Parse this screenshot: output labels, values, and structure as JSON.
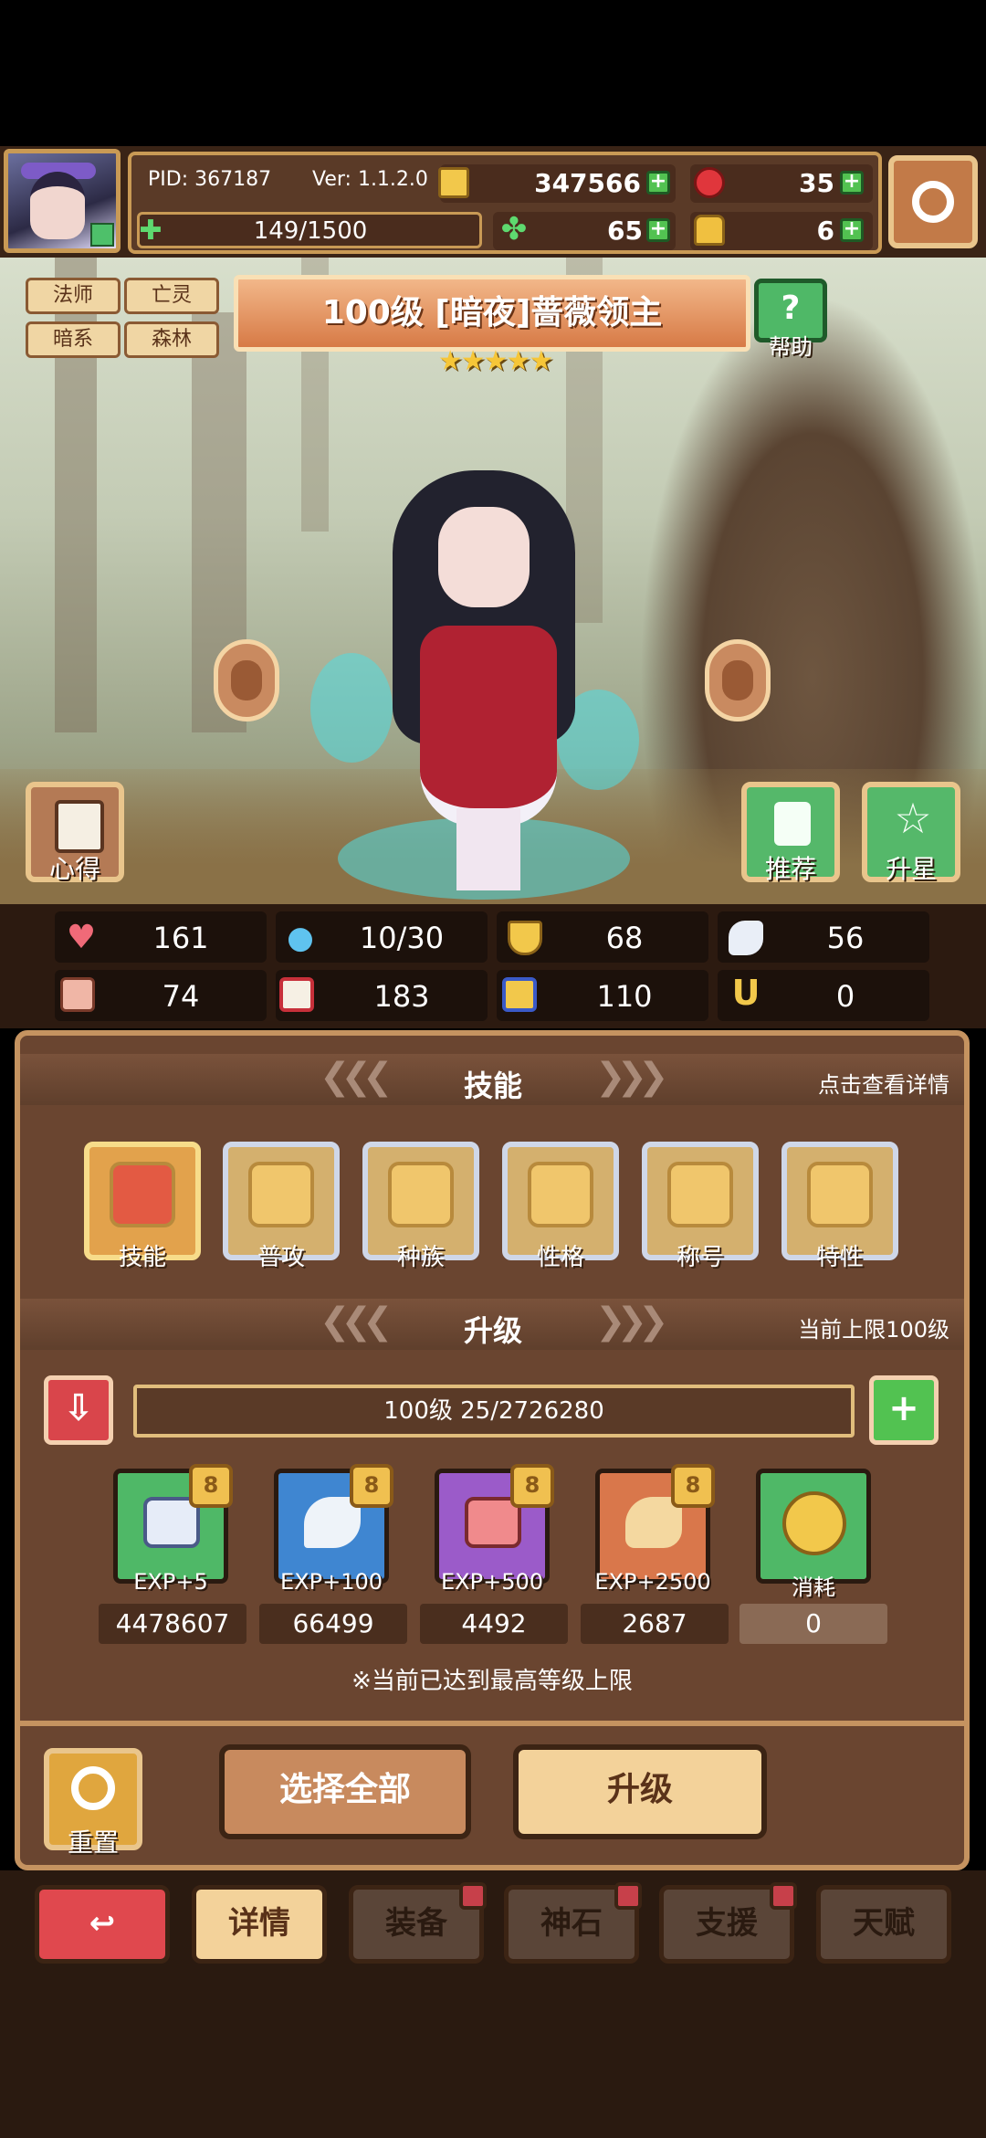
{
  "header": {
    "pid": "PID: 367187",
    "version": "Ver: 1.1.2.0",
    "gold": "347566",
    "ruby": "35",
    "stamina": "149/1500",
    "clover": "65",
    "bag": "6"
  },
  "hero": {
    "tags": [
      "法师",
      "亡灵",
      "暗系",
      "森林"
    ],
    "title": "100级 [暗夜]蔷薇领主",
    "stars": "★★★★★",
    "help_label": "帮助",
    "notes_label": "心得",
    "recommend_label": "推荐",
    "upgrade_star_label": "升星"
  },
  "stats": {
    "hp": "161",
    "mana": "10/30",
    "defense": "68",
    "speed": "56",
    "attack": "74",
    "magic": "183",
    "resist": "110",
    "luck": "0"
  },
  "skills_section": {
    "title": "技能",
    "note": "点击查看详情",
    "items": [
      "技能",
      "普攻",
      "种族",
      "性格",
      "称号",
      "特性"
    ]
  },
  "level_section": {
    "title": "升级",
    "note": "当前上限100级",
    "progress": "100级  25/2726280",
    "items": [
      {
        "label": "EXP+5",
        "count": "4478607"
      },
      {
        "label": "EXP+100",
        "count": "66499"
      },
      {
        "label": "EXP+500",
        "count": "4492"
      },
      {
        "label": "EXP+2500",
        "count": "2687"
      },
      {
        "label": "消耗",
        "count": "0"
      }
    ],
    "notice": "※当前已达到最高等级上限"
  },
  "actions": {
    "reset": "重置",
    "select_all": "选择全部",
    "upgrade": "升级"
  },
  "nav": {
    "details": "详情",
    "equip": "装备",
    "godstone": "神石",
    "support": "支援",
    "talent": "天赋"
  },
  "colors": {
    "panel": "#6a4530",
    "accent_gold": "#e1bd7c",
    "green": "#52c251",
    "red": "#e0363c"
  }
}
